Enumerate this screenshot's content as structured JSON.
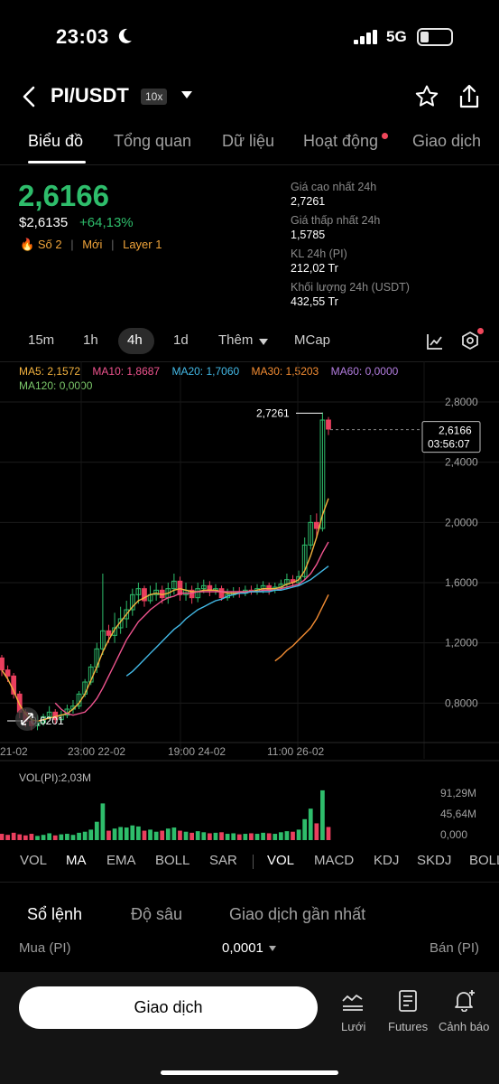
{
  "status": {
    "time": "23:03",
    "network": "5G"
  },
  "header": {
    "pair": "PI/USDT",
    "leverage": "10x"
  },
  "tabs": [
    "Biểu đồ",
    "Tổng quan",
    "Dữ liệu",
    "Hoạt động",
    "Giao dịch"
  ],
  "ticker": {
    "price": "2,6166",
    "usd_price": "$2,6135",
    "change": "+64,13%",
    "tag_rank": "Số 2",
    "tag_new": "Mới",
    "tag_layer": "Layer 1",
    "sep": "|"
  },
  "stats": [
    {
      "label": "Giá cao nhất 24h",
      "value": "2,7261"
    },
    {
      "label": "Giá thấp nhất 24h",
      "value": "1,5785"
    },
    {
      "label": "KL 24h (PI)",
      "value": "212,02 Tr"
    },
    {
      "label": "Khối lượng 24h (USDT)",
      "value": "432,55 Tr"
    }
  ],
  "timeframes": [
    "15m",
    "1h",
    "4h",
    "1d",
    "Thêm",
    "MCap"
  ],
  "ma_legend": {
    "ma5": "MA5: 2,1572",
    "ma10": "MA10: 1,8687",
    "ma20": "MA20: 1,7060",
    "ma30": "MA30: 1,5203",
    "ma60": "MA60: 0,0000",
    "ma120": "MA120: 0,0000"
  },
  "colors": {
    "up": "#2ebd6b",
    "down": "#ea3f5e",
    "ma5": "#f4b33f",
    "ma10": "#f0548f",
    "ma20": "#43b9e6",
    "ma30": "#f48d33",
    "ma60": "#b37de0",
    "ma120": "#7cc96b"
  },
  "chart_data": {
    "type": "candlestick",
    "price_axis": [
      "2,8000",
      "2,4000",
      "2,0000",
      "1,6000",
      "1,2000",
      "0,8000"
    ],
    "ylim": [
      0.55,
      2.95
    ],
    "time_axis": [
      "21-02",
      "23:00 22-02",
      "19:00 24-02",
      "11:00 26-02"
    ],
    "high_label": "2,7261",
    "low_label": "0,6201",
    "current_price": "2,6166",
    "countdown": "03:56:07",
    "candles": [
      [
        1.1,
        1.02,
        1.12,
        0.98
      ],
      [
        1.02,
        0.98,
        1.05,
        0.94
      ],
      [
        0.98,
        0.86,
        1.0,
        0.83
      ],
      [
        0.86,
        0.74,
        0.88,
        0.7
      ],
      [
        0.74,
        0.68,
        0.76,
        0.64
      ],
      [
        0.68,
        0.65,
        0.7,
        0.62
      ],
      [
        0.65,
        0.67,
        0.72,
        0.62
      ],
      [
        0.67,
        0.71,
        0.73,
        0.65
      ],
      [
        0.71,
        0.74,
        0.78,
        0.69
      ],
      [
        0.74,
        0.69,
        0.76,
        0.66
      ],
      [
        0.69,
        0.72,
        0.75,
        0.67
      ],
      [
        0.72,
        0.76,
        0.79,
        0.7
      ],
      [
        0.76,
        0.78,
        0.82,
        0.73
      ],
      [
        0.78,
        0.86,
        0.88,
        0.76
      ],
      [
        0.86,
        0.94,
        0.96,
        0.84
      ],
      [
        0.94,
        1.04,
        1.06,
        0.92
      ],
      [
        1.04,
        1.16,
        1.2,
        1.0
      ],
      [
        1.16,
        1.28,
        1.66,
        1.12
      ],
      [
        1.28,
        1.25,
        1.32,
        1.2
      ],
      [
        1.25,
        1.3,
        1.4,
        1.2
      ],
      [
        1.3,
        1.36,
        1.44,
        1.26
      ],
      [
        1.36,
        1.42,
        1.48,
        1.3
      ],
      [
        1.42,
        1.52,
        1.56,
        1.38
      ],
      [
        1.52,
        1.56,
        1.6,
        1.46
      ],
      [
        1.56,
        1.48,
        1.58,
        1.44
      ],
      [
        1.48,
        1.52,
        1.58,
        1.46
      ],
      [
        1.52,
        1.55,
        1.6,
        1.48
      ],
      [
        1.55,
        1.5,
        1.58,
        1.46
      ],
      [
        1.5,
        1.56,
        1.6,
        1.46
      ],
      [
        1.56,
        1.61,
        1.66,
        1.52
      ],
      [
        1.61,
        1.52,
        1.64,
        1.48
      ],
      [
        1.52,
        1.55,
        1.6,
        1.48
      ],
      [
        1.55,
        1.5,
        1.58,
        1.46
      ],
      [
        1.5,
        1.56,
        1.6,
        1.47
      ],
      [
        1.56,
        1.58,
        1.62,
        1.53
      ],
      [
        1.58,
        1.55,
        1.61,
        1.51
      ],
      [
        1.55,
        1.56,
        1.59,
        1.52
      ],
      [
        1.56,
        1.5,
        1.58,
        1.48
      ],
      [
        1.5,
        1.52,
        1.56,
        1.48
      ],
      [
        1.52,
        1.54,
        1.57,
        1.5
      ],
      [
        1.54,
        1.53,
        1.57,
        1.5
      ],
      [
        1.53,
        1.55,
        1.58,
        1.51
      ],
      [
        1.55,
        1.54,
        1.58,
        1.52
      ],
      [
        1.54,
        1.56,
        1.59,
        1.52
      ],
      [
        1.56,
        1.58,
        1.61,
        1.53
      ],
      [
        1.58,
        1.55,
        1.6,
        1.52
      ],
      [
        1.55,
        1.57,
        1.6,
        1.53
      ],
      [
        1.57,
        1.59,
        1.62,
        1.55
      ],
      [
        1.59,
        1.62,
        1.66,
        1.56
      ],
      [
        1.62,
        1.6,
        1.65,
        1.57
      ],
      [
        1.6,
        1.64,
        1.68,
        1.58
      ],
      [
        1.64,
        1.85,
        1.9,
        1.62
      ],
      [
        1.85,
        2.0,
        2.05,
        1.82
      ],
      [
        2.0,
        1.96,
        2.06,
        1.9
      ],
      [
        1.96,
        2.68,
        2.73,
        1.94
      ],
      [
        2.68,
        2.62,
        2.7,
        2.58
      ]
    ],
    "ma_lines": {
      "ma5": [
        1.02,
        0.96,
        0.88,
        0.79,
        0.73,
        0.69,
        0.68,
        0.69,
        0.7,
        0.71,
        0.72,
        0.73,
        0.76,
        0.8,
        0.86,
        0.95,
        1.04,
        1.14,
        1.22,
        1.29,
        1.34,
        1.39,
        1.44,
        1.48,
        1.5,
        1.52,
        1.53,
        1.52,
        1.53,
        1.55,
        1.56,
        1.55,
        1.54,
        1.54,
        1.55,
        1.55,
        1.55,
        1.54,
        1.53,
        1.53,
        1.53,
        1.54,
        1.54,
        1.55,
        1.56,
        1.56,
        1.56,
        1.57,
        1.59,
        1.6,
        1.62,
        1.68,
        1.78,
        1.9,
        2.05,
        2.16
      ],
      "ma10": [
        null,
        null,
        null,
        null,
        null,
        null,
        null,
        null,
        null,
        0.8,
        0.76,
        0.73,
        0.72,
        0.73,
        0.74,
        0.78,
        0.83,
        0.9,
        0.98,
        1.06,
        1.14,
        1.22,
        1.28,
        1.34,
        1.38,
        1.42,
        1.45,
        1.48,
        1.5,
        1.51,
        1.53,
        1.53,
        1.53,
        1.54,
        1.54,
        1.54,
        1.54,
        1.54,
        1.54,
        1.54,
        1.54,
        1.54,
        1.54,
        1.54,
        1.55,
        1.55,
        1.55,
        1.56,
        1.57,
        1.58,
        1.59,
        1.62,
        1.66,
        1.72,
        1.8,
        1.87
      ],
      "ma20": [
        null,
        null,
        null,
        null,
        null,
        null,
        null,
        null,
        null,
        null,
        null,
        null,
        null,
        null,
        null,
        null,
        null,
        null,
        null,
        null,
        null,
        0.98,
        1.01,
        1.05,
        1.09,
        1.13,
        1.17,
        1.21,
        1.25,
        1.29,
        1.32,
        1.36,
        1.39,
        1.42,
        1.44,
        1.46,
        1.48,
        1.49,
        1.51,
        1.52,
        1.53,
        1.53,
        1.54,
        1.54,
        1.54,
        1.54,
        1.55,
        1.55,
        1.56,
        1.57,
        1.58,
        1.6,
        1.62,
        1.65,
        1.68,
        1.71
      ],
      "ma30": [
        null,
        null,
        null,
        null,
        null,
        null,
        null,
        null,
        null,
        null,
        null,
        null,
        null,
        null,
        null,
        null,
        null,
        null,
        null,
        null,
        null,
        null,
        null,
        null,
        null,
        null,
        null,
        null,
        null,
        null,
        null,
        null,
        null,
        null,
        null,
        null,
        null,
        null,
        null,
        null,
        null,
        null,
        null,
        null,
        null,
        null,
        1.08,
        1.11,
        1.15,
        1.18,
        1.22,
        1.26,
        1.3,
        1.36,
        1.44,
        1.52
      ]
    },
    "volume_axis": [
      "91,29M",
      "45,64M",
      "0,000"
    ],
    "volume": [
      12,
      10,
      14,
      11,
      9,
      12,
      8,
      10,
      13,
      9,
      11,
      12,
      10,
      14,
      16,
      20,
      35,
      70,
      18,
      22,
      25,
      24,
      28,
      26,
      18,
      20,
      16,
      18,
      22,
      24,
      18,
      16,
      14,
      17,
      15,
      13,
      14,
      15,
      12,
      13,
      11,
      12,
      13,
      12,
      14,
      13,
      12,
      15,
      17,
      16,
      20,
      40,
      60,
      32,
      95,
      25
    ],
    "volume_max": 100
  },
  "volume_label": "VOL(PI):2,03M",
  "indicator_tabs": [
    "VOL",
    "MA",
    "EMA",
    "BOLL",
    "SAR",
    "VOL",
    "MACD",
    "KDJ",
    "SKDJ",
    "BOLL"
  ],
  "orderbook": {
    "tabs": [
      "Sổ lệnh",
      "Độ sâu",
      "Giao dịch gần nhất"
    ],
    "buy_label": "Mua (PI)",
    "precision": "0,0001",
    "sell_label": "Bán (PI)"
  },
  "bottom_nav": {
    "trade_button": "Giao dịch",
    "items": [
      "Lưới",
      "Futures",
      "Cảnh báo"
    ]
  }
}
